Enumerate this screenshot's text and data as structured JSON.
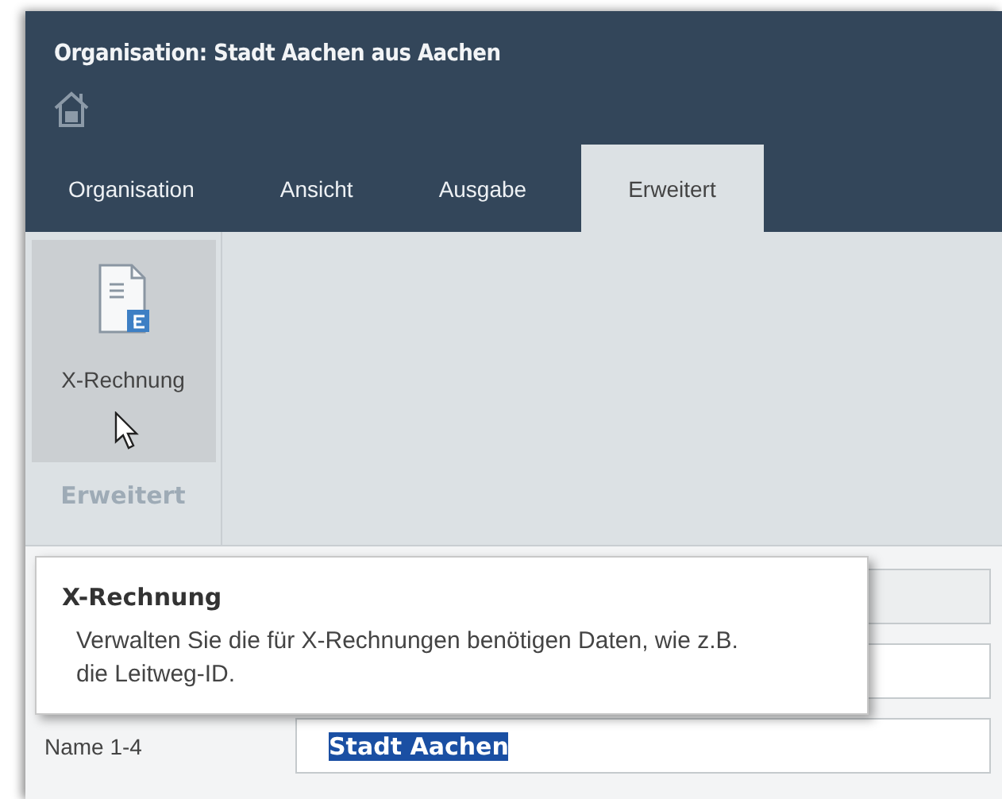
{
  "window": {
    "title": "Organisation: Stadt Aachen aus Aachen"
  },
  "tabs": [
    {
      "label": "Organisation",
      "selected": false
    },
    {
      "label": "Ansicht",
      "selected": false
    },
    {
      "label": "Ausgabe",
      "selected": false
    },
    {
      "label": "Erweitert",
      "selected": true
    }
  ],
  "ribbon": {
    "buttons": [
      {
        "label": "X-Rechnung",
        "hovered": true
      }
    ],
    "group_label": "Erweitert"
  },
  "form": {
    "fields": [
      {
        "kind": "readonly"
      },
      {
        "kind": "editable"
      },
      {
        "kind": "editable",
        "label": "Name 1-4",
        "value": "Stadt Aachen",
        "highlighted": true
      }
    ]
  },
  "tooltip": {
    "title": "X-Rechnung",
    "text": "Verwalten Sie die für X-Rechnungen benötigen Daten, wie z.B. die Leitweg-ID."
  }
}
